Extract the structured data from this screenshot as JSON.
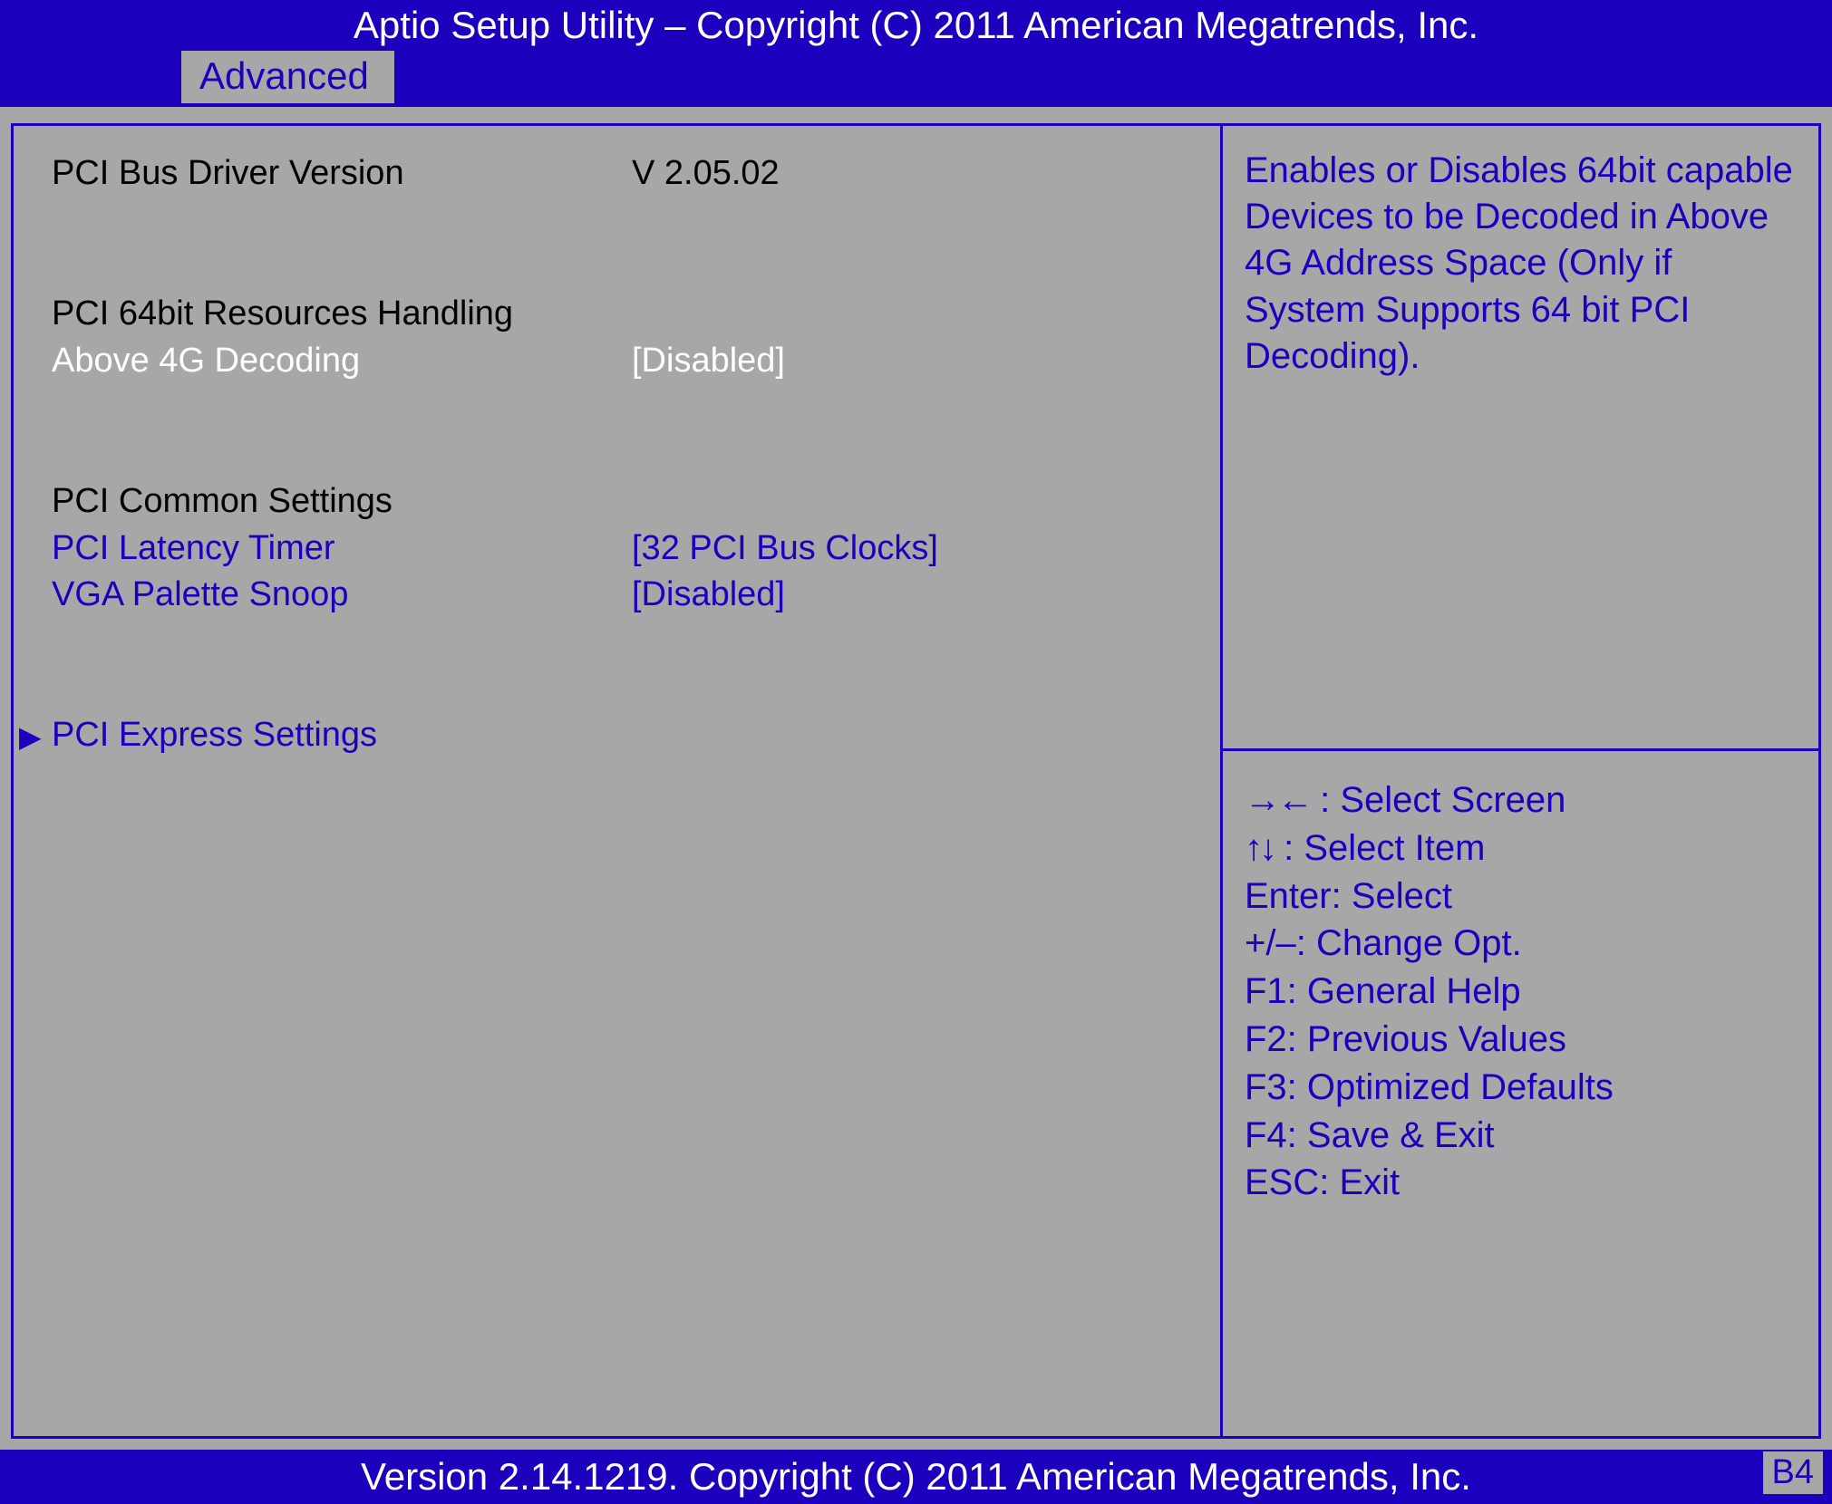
{
  "header": {
    "title": "Aptio Setup Utility – Copyright (C) 2011 American Megatrends, Inc."
  },
  "tabs": {
    "active": "Advanced"
  },
  "settings": {
    "pci_bus_driver_label": "PCI Bus Driver Version",
    "pci_bus_driver_value": "V 2.05.02",
    "pci64_header": "PCI 64bit Resources Handling",
    "above4g_label": "Above 4G Decoding",
    "above4g_value": "[Disabled]",
    "pci_common_header": "PCI Common Settings",
    "latency_label": "PCI Latency Timer",
    "latency_value": "[32 PCI Bus Clocks]",
    "vga_label": "VGA Palette Snoop",
    "vga_value": "[Disabled]",
    "pcie_submenu": "PCI Express Settings"
  },
  "help": {
    "text": "Enables or Disables 64bit capable Devices to be Decoded in Above 4G Address Space (Only if System Supports 64 bit PCI Decoding)."
  },
  "keys": {
    "select_screen": ": Select Screen",
    "select_item": ": Select Item",
    "enter": "Enter: Select",
    "change": "+/–: Change Opt.",
    "f1": "F1: General Help",
    "f2": "F2: Previous Values",
    "f3": "F3: Optimized Defaults",
    "f4": "F4: Save & Exit",
    "esc": "ESC: Exit"
  },
  "footer": {
    "text": "Version 2.14.1219. Copyright (C) 2011 American Megatrends, Inc.",
    "badge": "B4"
  }
}
